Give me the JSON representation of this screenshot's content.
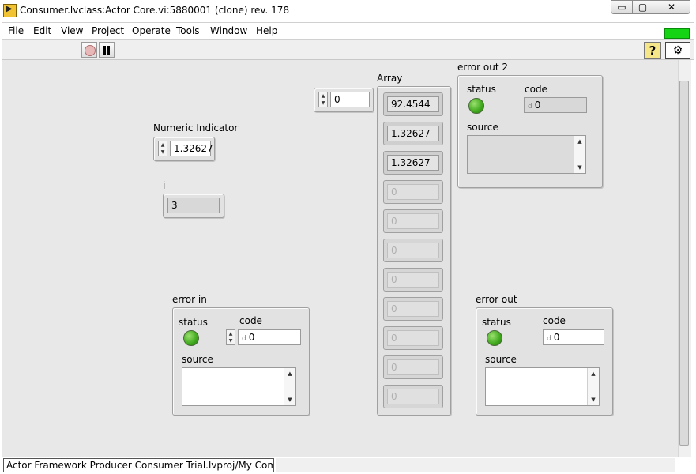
{
  "window": {
    "title": "Consumer.lvclass:Actor Core.vi:5880001 (clone) rev. 178",
    "minimize_glyph": "▭",
    "maximize_glyph": "▢",
    "close_glyph": "✕"
  },
  "menu": {
    "items": [
      "File",
      "Edit",
      "View",
      "Project",
      "Operate",
      "Tools",
      "Window",
      "Help"
    ]
  },
  "toolbar": {
    "help_glyph": "?",
    "vi_icon_glyph": "⚙"
  },
  "controls": {
    "numeric_indicator": {
      "label": "Numeric Indicator",
      "value": "1.32627"
    },
    "i_indicator": {
      "label": "i",
      "value": "3"
    },
    "index_control": {
      "value": "0"
    },
    "array": {
      "label": "Array",
      "values": [
        "92.4544",
        "1.32627",
        "1.32627",
        "0",
        "0",
        "0",
        "0",
        "0",
        "0",
        "0",
        "0"
      ]
    },
    "error_out_2": {
      "label": "error out 2",
      "status_label": "status",
      "code_label": "code",
      "code_prefix": "d",
      "code_value": "0",
      "source_label": "source",
      "source_value": ""
    },
    "error_in": {
      "label": "error in",
      "status_label": "status",
      "code_label": "code",
      "code_prefix": "d",
      "code_value": "0",
      "source_label": "source",
      "source_value": ""
    },
    "error_out": {
      "label": "error out",
      "status_label": "status",
      "code_label": "code",
      "code_prefix": "d",
      "code_value": "0",
      "source_label": "source",
      "source_value": ""
    }
  },
  "status_bar": {
    "project_path": "Actor Framework Producer Consumer Trial.lvproj/My Computer"
  },
  "colors": {
    "run_indicator": "#14d414",
    "status_led": "#3ea81c",
    "panel_bg": "#e8e8e8"
  }
}
